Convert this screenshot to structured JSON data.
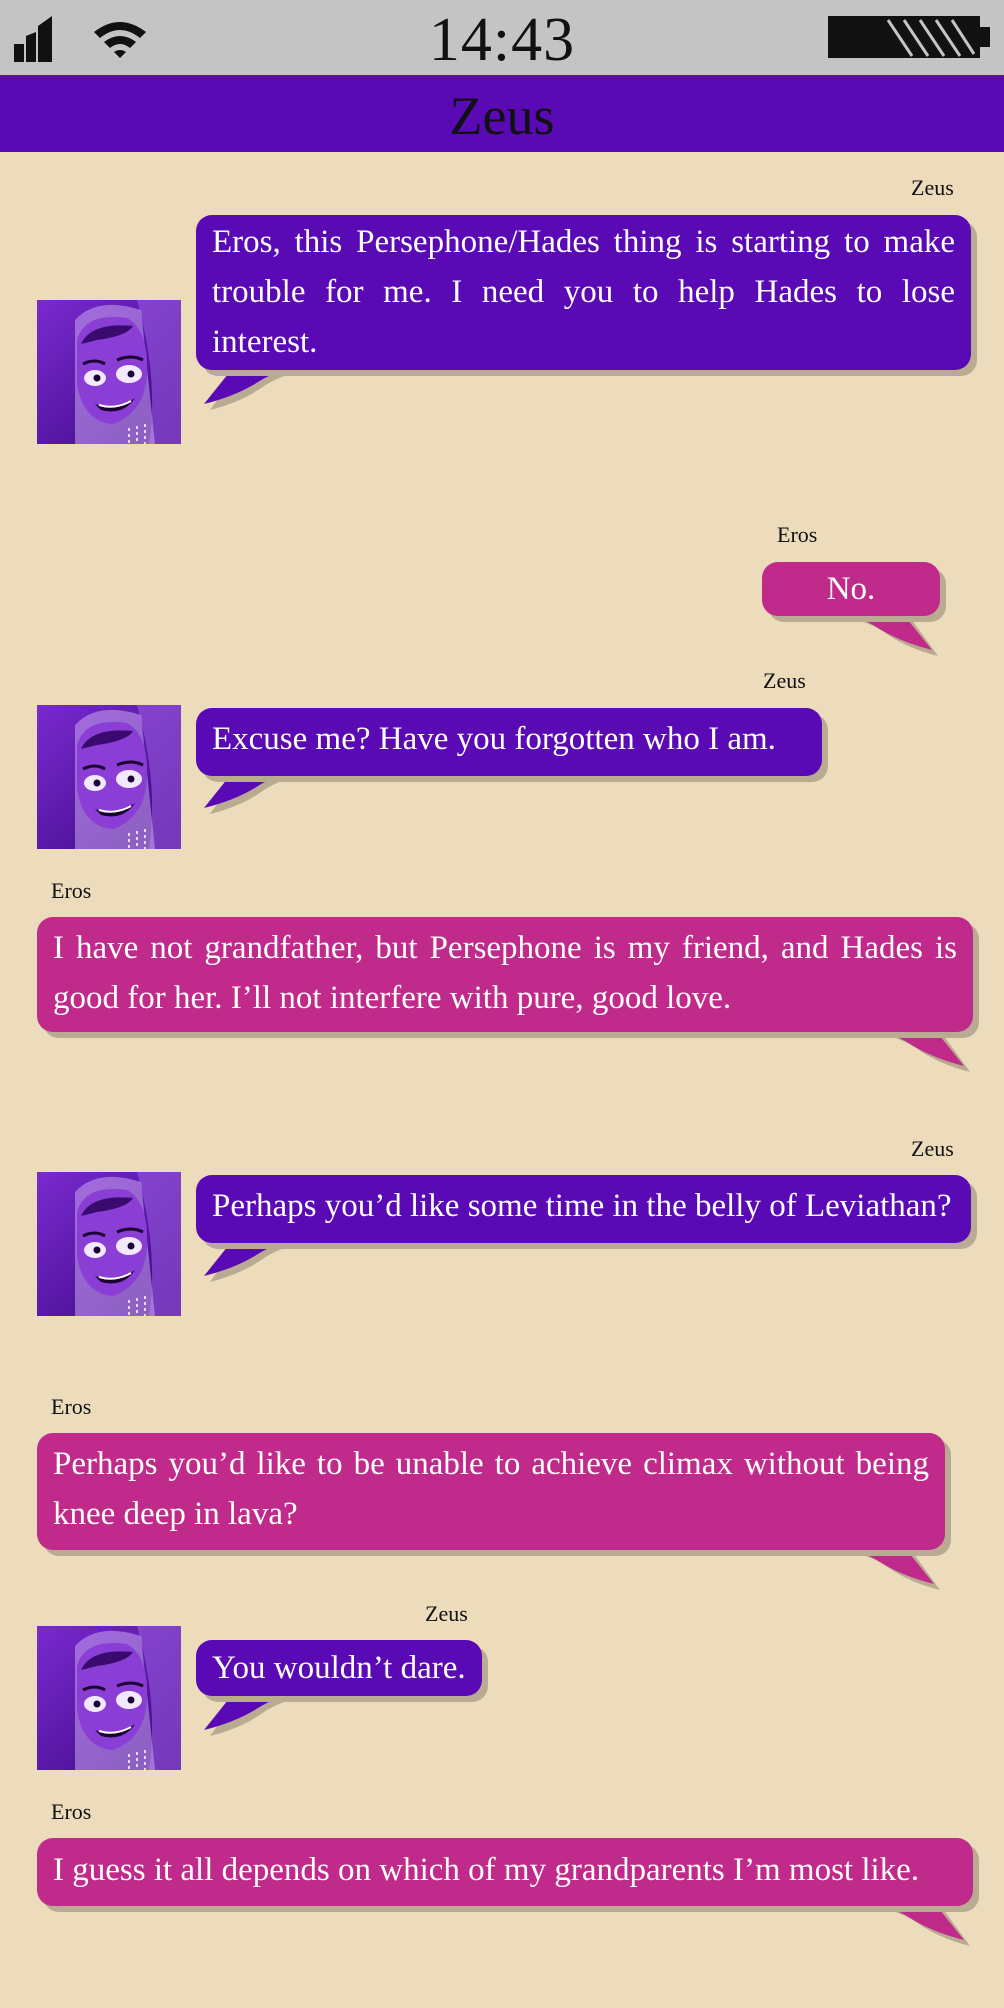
{
  "status_bar": {
    "time": "14:43"
  },
  "header": {
    "title": "Zeus"
  },
  "colors": {
    "status_bar": "#c4c4c4",
    "header": "#5a0ab4",
    "background": "#ecdcbc",
    "zeus_bubble": "#5a0ab4",
    "eros_bubble": "#c02a8a"
  },
  "messages": [
    {
      "sender": "Zeus",
      "text": "Eros, this Persephone/Hades thing is starting to make trouble for me.  I need you to help Hades to lose interest."
    },
    {
      "sender": "Eros",
      "text": "No."
    },
    {
      "sender": "Zeus",
      "text": "Excuse me? Have you forgotten who I am."
    },
    {
      "sender": "Eros",
      "text": "I have not grandfather, but Persephone is my friend, and Hades is good for her. I’ll not interfere with pure, good love."
    },
    {
      "sender": "Zeus",
      "text": "Perhaps you’d like some time in the belly of Leviathan?"
    },
    {
      "sender": "Eros",
      "text": "Perhaps you’d like to be unable to achieve climax without being knee deep in lava?"
    },
    {
      "sender": "Zeus",
      "text": "You wouldn’t dare."
    },
    {
      "sender": "Eros",
      "text": "I guess it all depends on which of my grandparents I’m most like."
    }
  ]
}
